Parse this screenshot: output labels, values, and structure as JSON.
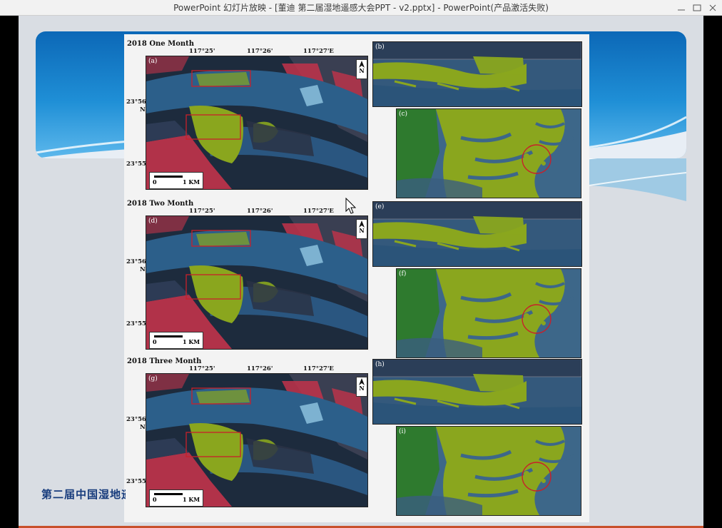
{
  "window": {
    "title": "PowerPoint 幻灯片放映 - [董迪 第二届湿地遥感大会PPT - v2.pptx] - PowerPoint(产品激活失败)"
  },
  "footer": {
    "text": "第二届中国湿地遥感大会"
  },
  "colors": {
    "vegetation": "#8aa61e",
    "water": "#2c5f8a",
    "urban": "#c2334a",
    "banner": "#1f8fd6"
  },
  "icons": {
    "north_arrow": "north-arrow-icon",
    "cursor": "mouse-pointer-icon"
  },
  "sections": [
    {
      "title": "2018 One Month",
      "overview_tag": "(a)",
      "detail1_tag": "(b)",
      "detail2_tag": "(c)",
      "lon_labels": [
        "117°25'",
        "117°26'",
        "117°27'E"
      ],
      "lat_top": "23°56'",
      "lat_top_n": "N",
      "lat_bottom": "23°55'",
      "north": "N",
      "scale_zero": "0",
      "scale_label": "1 KM"
    },
    {
      "title": "2018 Two Month",
      "overview_tag": "(d)",
      "detail1_tag": "(e)",
      "detail2_tag": "(f)",
      "lon_labels": [
        "117°25'",
        "117°26'",
        "117°27'E"
      ],
      "lat_top": "23°56'",
      "lat_top_n": "N",
      "lat_bottom": "23°55'",
      "north": "N",
      "scale_zero": "0",
      "scale_label": "1 KM"
    },
    {
      "title": "2018 Three Month",
      "overview_tag": "(g)",
      "detail1_tag": "(h)",
      "detail2_tag": "(i)",
      "lon_labels": [
        "117°25'",
        "117°26'",
        "117°27'E"
      ],
      "lat_top": "23°56'",
      "lat_top_n": "N",
      "lat_bottom": "23°55'",
      "north": "N",
      "scale_zero": "0",
      "scale_label": "1 KM"
    }
  ]
}
